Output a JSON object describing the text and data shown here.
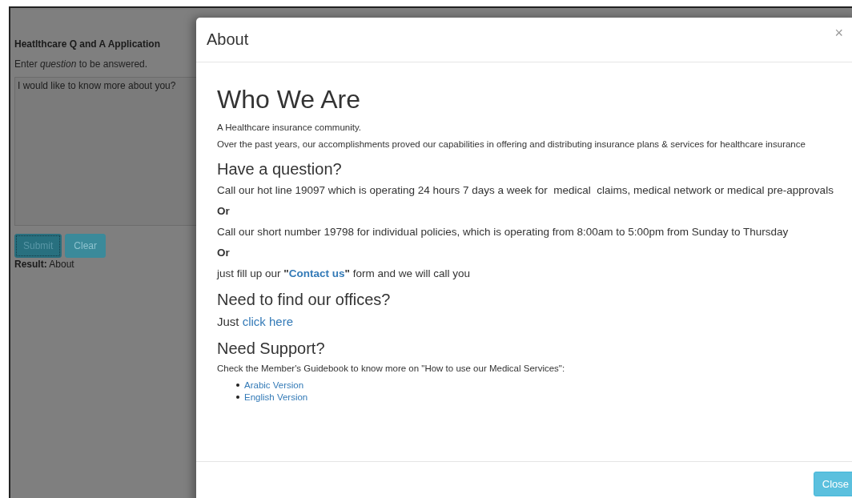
{
  "app": {
    "title": "Heatlthcare Q and A Application",
    "instruction": "Enter *question* to be answered.",
    "question": {
      "value": "I would like to know more about you?"
    },
    "buttons": [
      {
        "label": "Submit",
        "kind": "primary",
        "focused": true
      },
      {
        "label": "Clear",
        "kind": "secondary",
        "focused": false
      }
    ],
    "result": {
      "label": "Result:",
      "value": "About"
    }
  },
  "modal": {
    "title": "About",
    "close_glyph": "×",
    "heading": "Who We Are",
    "intro": [
      "A Healthcare insurance community.",
      "Over the past years, our accomplishments proved our capabilities in offering and distributing insurance plans & services for healthcare insurance"
    ],
    "sections": [
      {
        "heading": "Have a question?",
        "items": [
          {
            "kind": "text",
            "text": "Call our hot line 19097 which is operating 24 hours 7 days a week for  medical  claims, medical network or medical pre-approvals"
          },
          {
            "kind": "or",
            "text": "Or"
          },
          {
            "kind": "text",
            "text": "Call our short number 19798 for individual policies, which is operating from 8:00am to 5:00pm from Sunday to Thursday"
          },
          {
            "kind": "or",
            "text": "Or"
          },
          {
            "kind": "link",
            "before": "just fill up our ",
            "open": "\"",
            "link": "Contact us",
            "close": "\"",
            "after": " form and we will call you"
          }
        ]
      },
      {
        "heading": "Need to find our offices?",
        "items": [
          {
            "kind": "link",
            "before": "Just ",
            "link": "click here"
          }
        ]
      },
      {
        "heading": "Need Support?",
        "items": [
          {
            "kind": "small",
            "text": "Check the Member's Guidebook to know more on \"How to use our Medical Services\":"
          },
          {
            "kind": "list",
            "links": [
              "Arabic Version",
              "English Version"
            ]
          }
        ]
      }
    ],
    "footer_button": "Close"
  }
}
